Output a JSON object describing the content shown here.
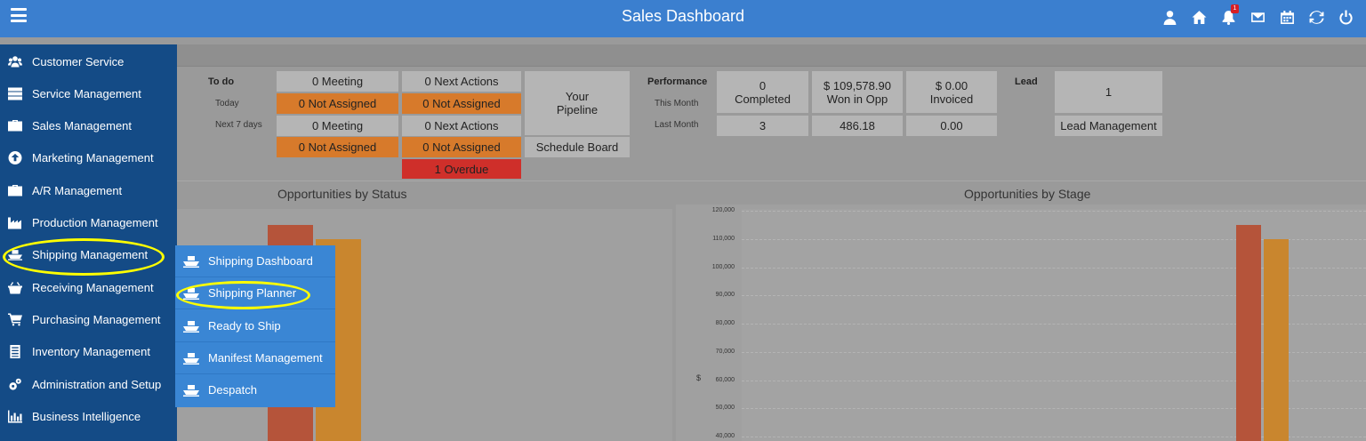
{
  "header": {
    "title": "Sales Dashboard",
    "notification_count": "1",
    "icons": [
      "user-icon",
      "home-icon",
      "bell-icon",
      "mail-icon",
      "calendar-icon",
      "refresh-icon",
      "power-icon"
    ]
  },
  "sidebar": {
    "items": [
      {
        "label": "Customer Service",
        "icon": "users-icon"
      },
      {
        "label": "Service Management",
        "icon": "server-icon"
      },
      {
        "label": "Sales Management",
        "icon": "briefcase-icon"
      },
      {
        "label": "Marketing Management",
        "icon": "arrow-circle-up-icon"
      },
      {
        "label": "A/R Management",
        "icon": "briefcase-icon"
      },
      {
        "label": "Production Management",
        "icon": "industry-icon"
      },
      {
        "label": "Shipping Management",
        "icon": "ship-icon"
      },
      {
        "label": "Receiving Management",
        "icon": "basket-icon"
      },
      {
        "label": "Purchasing Management",
        "icon": "cart-icon"
      },
      {
        "label": "Inventory Management",
        "icon": "list-icon"
      },
      {
        "label": "Administration and Setup",
        "icon": "cogs-icon"
      },
      {
        "label": "Business Intelligence",
        "icon": "bar-chart-icon"
      }
    ]
  },
  "submenu": {
    "items": [
      {
        "label": "Shipping Dashboard"
      },
      {
        "label": "Shipping Planner"
      },
      {
        "label": "Ready to Ship"
      },
      {
        "label": "Manifest Management"
      },
      {
        "label": "Despatch"
      }
    ]
  },
  "todo": {
    "title": "To do",
    "today": "Today",
    "next7": "Next 7 days",
    "today_meeting": "0 Meeting",
    "today_meeting_na": "0 Not Assigned",
    "today_actions": "0 Next Actions",
    "today_actions_na": "0 Not Assigned",
    "next_meeting": "0 Meeting",
    "next_meeting_na": "0 Not Assigned",
    "next_actions": "0 Next Actions",
    "next_actions_na": "0 Not Assigned",
    "overdue": "1 Overdue",
    "pipeline_line1": "Your",
    "pipeline_line2": "Pipeline",
    "schedule_board": "Schedule Board"
  },
  "performance": {
    "title": "Performance",
    "this_month": "This Month",
    "last_month": "Last Month",
    "completed_value": "0",
    "completed_label": "Completed",
    "won_value": "$ 109,578.90",
    "won_label": "Won in Opp",
    "invoiced_value": "$ 0.00",
    "invoiced_label": "Invoiced",
    "last_completed": "3",
    "last_won": "486.18",
    "last_invoiced": "0.00"
  },
  "lead": {
    "title": "Lead",
    "value": "1",
    "management": "Lead Management"
  },
  "chart_data": [
    {
      "type": "bar",
      "title": "Opportunities by Status",
      "series": [
        {
          "values": [
            115000
          ],
          "color": "#b5543a"
        },
        {
          "values": [
            110000
          ],
          "color": "#c9862e"
        }
      ]
    },
    {
      "type": "bar",
      "title": "Opportunities by Stage",
      "ylabel": "$",
      "ylim": [
        40000,
        120000
      ],
      "yticks": [
        "120,000",
        "110,000",
        "100,000",
        "90,000",
        "80,000",
        "70,000",
        "60,000",
        "50,000",
        "40,000"
      ],
      "series": [
        {
          "values": [
            115000
          ],
          "color": "#b5543a"
        },
        {
          "values": [
            110000
          ],
          "color": "#c9862e"
        }
      ]
    }
  ]
}
